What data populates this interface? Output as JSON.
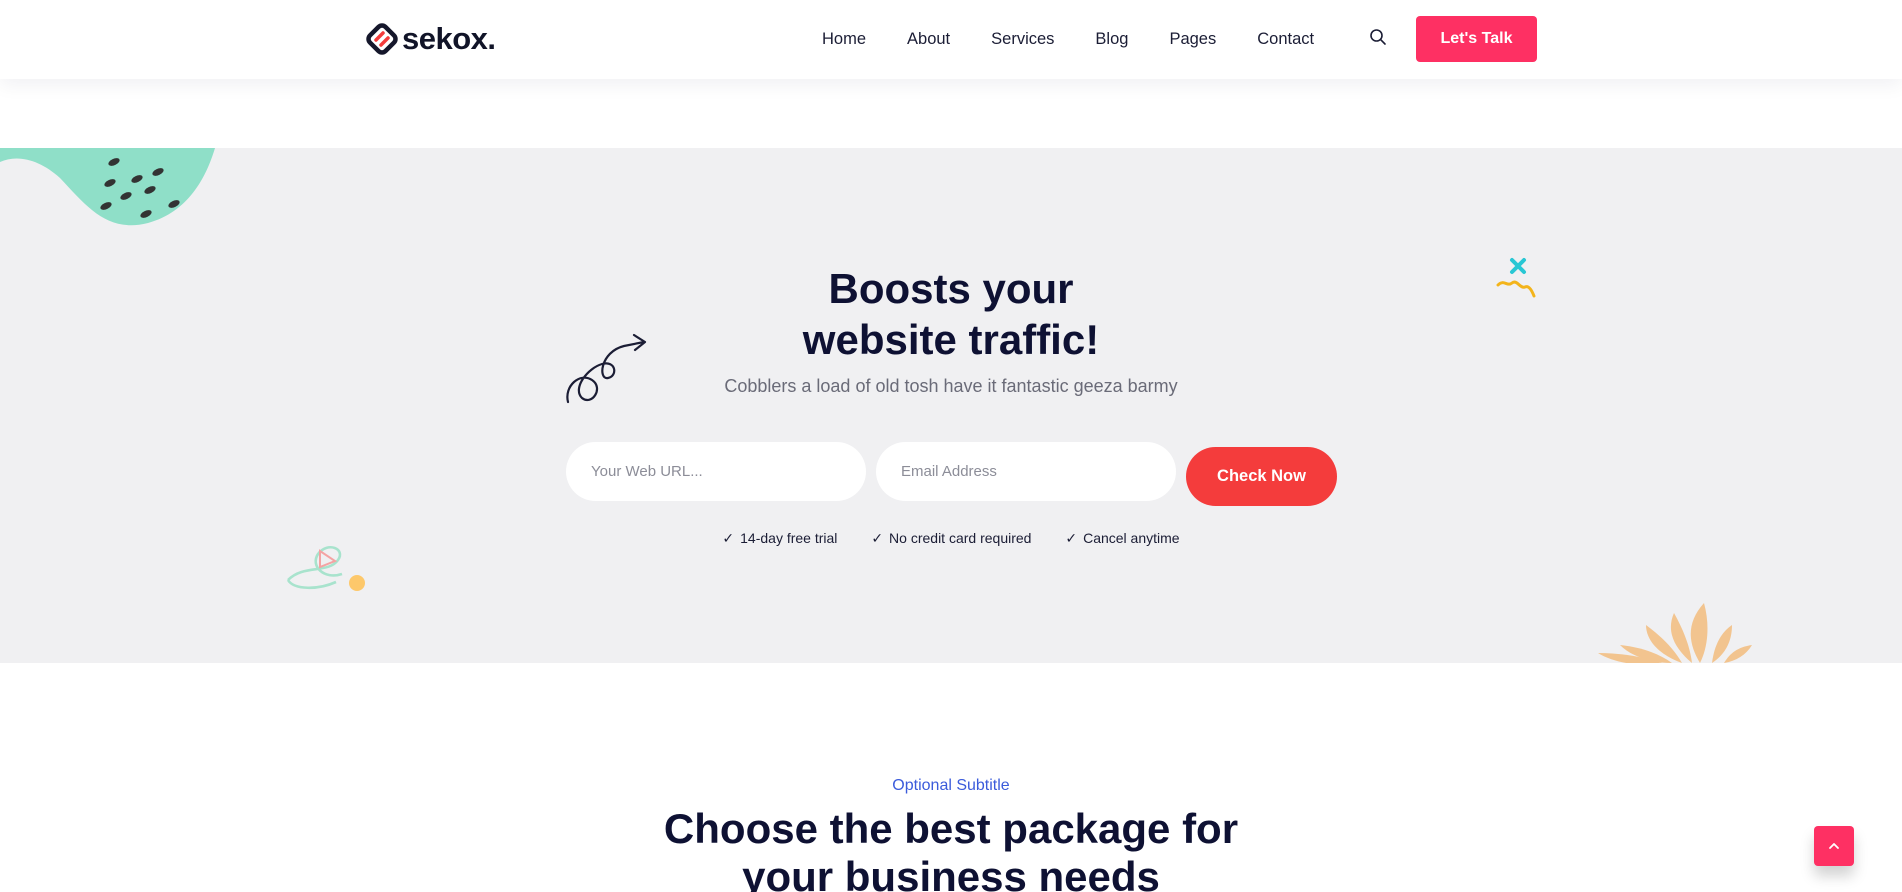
{
  "brand": {
    "name": "sekox."
  },
  "nav": {
    "items": [
      "Home",
      "About",
      "Services",
      "Blog",
      "Pages",
      "Contact"
    ]
  },
  "header": {
    "cta_label": "Let's Talk"
  },
  "hero": {
    "title_line1": "Boosts your",
    "title_line2": "website traffic!",
    "subtitle": "Cobblers a load of old tosh have it fantastic geeza barmy",
    "url_placeholder": "Your Web URL...",
    "email_placeholder": "Email Address",
    "button_label": "Check Now",
    "features": [
      "14-day free trial",
      "No credit card required",
      "Cancel anytime"
    ]
  },
  "pricing": {
    "subtitle": "Optional Subtitle",
    "title_line1": "Choose the best package for",
    "title_line2": "your business needs"
  },
  "icons": {
    "search": "search-icon",
    "check": "check-icon",
    "scroll_top": "chevron-up-icon"
  },
  "colors": {
    "accent": "#fe3063",
    "check_button": "#f43c3c",
    "hero_bg": "#f0f0f2",
    "subtitle": "#3b5bdb",
    "heading": "#0e1133"
  }
}
